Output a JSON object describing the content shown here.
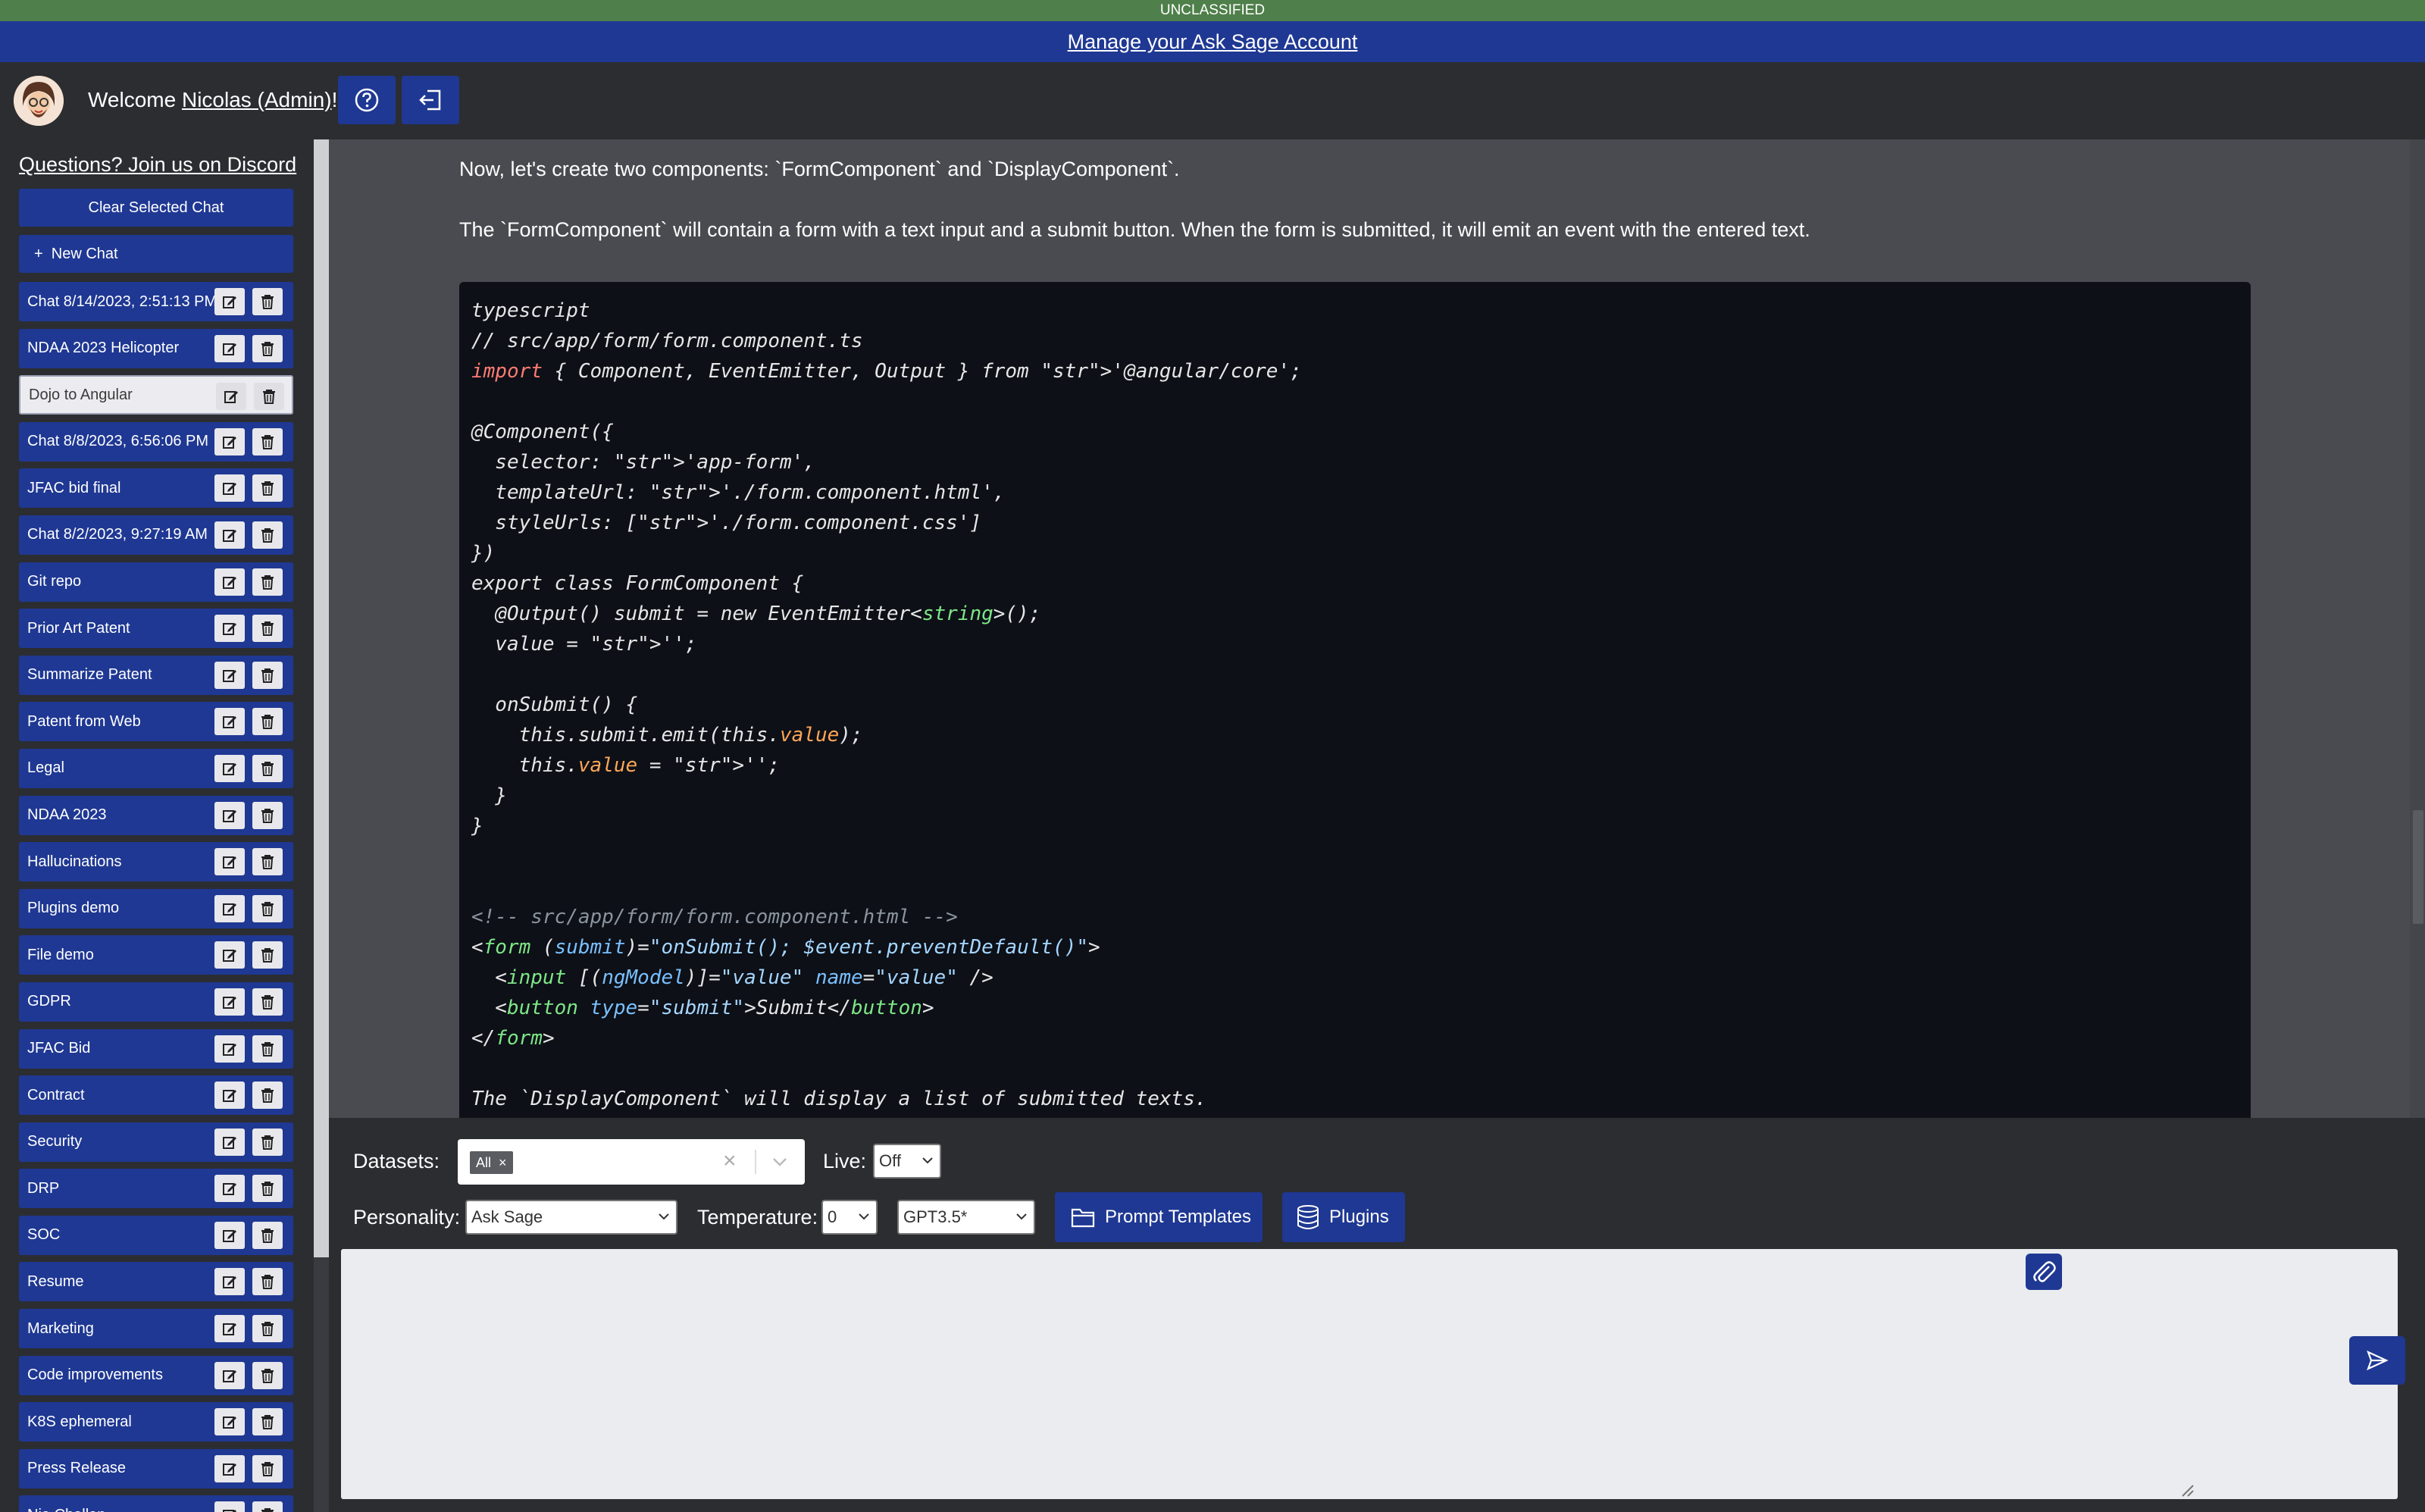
{
  "classification_banner": "UNCLASSIFIED",
  "manage_account_link": "Manage your Ask Sage Account",
  "header": {
    "welcome_prefix": "Welcome ",
    "user_name": "Nicolas (Admin)",
    "welcome_suffix": "!",
    "help_icon": "question-circle-icon",
    "logout_icon": "sign-out-icon"
  },
  "sidebar": {
    "discord_link": "Questions? Join us on Discord",
    "clear_button": "Clear Selected Chat",
    "new_chat_button": "+  New Chat",
    "chats": [
      {
        "label": "Chat 8/14/2023, 2:51:13 PM",
        "active": false
      },
      {
        "label": "NDAA 2023 Helicopter",
        "active": false
      },
      {
        "label": "Dojo to Angular",
        "active": true
      },
      {
        "label": "Chat 8/8/2023, 6:56:06 PM",
        "active": false
      },
      {
        "label": "JFAC bid final",
        "active": false
      },
      {
        "label": "Chat 8/2/2023, 9:27:19 AM",
        "active": false
      },
      {
        "label": "Git repo",
        "active": false
      },
      {
        "label": "Prior Art Patent",
        "active": false
      },
      {
        "label": "Summarize Patent",
        "active": false
      },
      {
        "label": "Patent from Web",
        "active": false
      },
      {
        "label": "Legal",
        "active": false
      },
      {
        "label": "NDAA 2023",
        "active": false
      },
      {
        "label": "Hallucinations",
        "active": false
      },
      {
        "label": "Plugins demo",
        "active": false
      },
      {
        "label": "File demo",
        "active": false
      },
      {
        "label": "GDPR",
        "active": false
      },
      {
        "label": "JFAC Bid",
        "active": false
      },
      {
        "label": "Contract",
        "active": false
      },
      {
        "label": "Security",
        "active": false
      },
      {
        "label": "DRP",
        "active": false
      },
      {
        "label": "SOC",
        "active": false
      },
      {
        "label": "Resume",
        "active": false
      },
      {
        "label": "Marketing",
        "active": false
      },
      {
        "label": "Code improvements",
        "active": false
      },
      {
        "label": "K8S ephemeral",
        "active": false
      },
      {
        "label": "Press Release",
        "active": false
      },
      {
        "label": "Nia Challan",
        "active": false
      }
    ]
  },
  "conversation": {
    "line1": "Now, let's create two components: `FormComponent` and `DisplayComponent`.",
    "line2": "The `FormComponent` will contain a form with a text input and a submit button. When the form is submitted, it will emit an event with the entered text.",
    "code_lines": [
      "typescript",
      "// src/app/form/form.component.ts",
      "import { Component, EventEmitter, Output } from '@angular/core';",
      "",
      "@Component({",
      "  selector: 'app-form',",
      "  templateUrl: './form.component.html',",
      "  styleUrls: ['./form.component.css']",
      "})",
      "export class FormComponent {",
      "  @Output() submit = new EventEmitter<string>();",
      "  value = '';",
      "",
      "  onSubmit() {",
      "    this.submit.emit(this.value);",
      "    this.value = '';",
      "  }",
      "}",
      "",
      "",
      "<!-- src/app/form/form.component.html -->",
      "<form (submit)=\"onSubmit(); $event.preventDefault()\">",
      "  <input [(ngModel)]=\"value\" name=\"value\" />",
      "  <button type=\"submit\">Submit</button>",
      "</form>",
      "",
      "The `DisplayComponent` will display a list of submitted texts."
    ]
  },
  "controls": {
    "datasets_label": "Datasets:",
    "datasets_chip": "All",
    "chip_remove": "×",
    "clear_icon": "×",
    "live_label": "Live:",
    "live_value": "Off",
    "personality_label": "Personality:",
    "personality_value": "Ask Sage",
    "temperature_label": "Temperature:",
    "temperature_value": "0",
    "model_value": "GPT3.5*",
    "prompt_templates_button": "Prompt Templates",
    "plugins_button": "Plugins",
    "message_input_placeholder": ""
  },
  "colors": {
    "brand_blue": "#1f3893",
    "classification_green": "#4f7f4a",
    "panel_dark": "#2c2d31",
    "chat_area": "#4a4b51",
    "code_bg": "#0d1017"
  }
}
